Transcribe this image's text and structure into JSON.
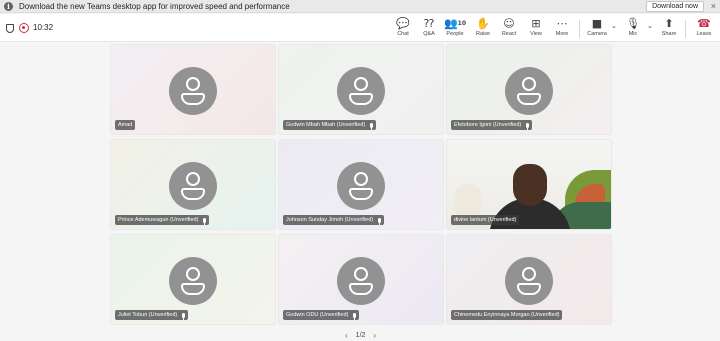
{
  "banner": {
    "message": "Download the new Teams desktop app for improved speed and performance",
    "download_label": "Download now",
    "close_glyph": "×"
  },
  "meeting": {
    "timer": "10:32"
  },
  "toolbar": {
    "chat": {
      "label": "Chat",
      "icon": "chat-icon",
      "glyph": "💬"
    },
    "qa": {
      "label": "Q&A",
      "icon": "qa-icon",
      "glyph": "⁇"
    },
    "people": {
      "label": "People",
      "icon": "people-icon",
      "glyph": "👥",
      "count": "10"
    },
    "raise": {
      "label": "Raise",
      "icon": "hand-icon",
      "glyph": "✋"
    },
    "react": {
      "label": "React",
      "icon": "smile-icon",
      "glyph": "☺"
    },
    "view": {
      "label": "View",
      "icon": "grid-icon",
      "glyph": "⊞"
    },
    "more": {
      "label": "More",
      "icon": "more-icon",
      "glyph": "⋯"
    },
    "camera": {
      "label": "Camera",
      "icon": "camera-icon",
      "glyph": "■"
    },
    "mic": {
      "label": "Mic",
      "icon": "mic-icon",
      "glyph": "🎙"
    },
    "share": {
      "label": "Share",
      "icon": "share-icon",
      "glyph": "⬆"
    },
    "leave": {
      "label": "Leave",
      "icon": "phone-hangup-icon",
      "glyph": "☎",
      "color": "#c4314b"
    },
    "caret_glyph": "⌄"
  },
  "participants": [
    {
      "name": "Amad",
      "mic": false
    },
    {
      "name": "Godwin Mbah Mbah (Unverified)",
      "mic": true
    },
    {
      "name": "Efetobore Igoni (Unverified)",
      "mic": true
    },
    {
      "name": "Prince Ademuwagun (Unverified)",
      "mic": true
    },
    {
      "name": "Johnson Sunday Jimoh (Unverified)",
      "mic": true
    },
    {
      "name": "divine lantum (Unverified)",
      "mic": false,
      "video": true
    },
    {
      "name": "Juliet Tobun (Unverified)",
      "mic": true
    },
    {
      "name": "Godwin ODU (Unverified)",
      "mic": true
    },
    {
      "name": "Chinemedu Enyinnaya Morgan (Unverified)",
      "mic": false
    }
  ],
  "pager": {
    "label": "1/2",
    "prev_glyph": "‹",
    "next_glyph": "›"
  },
  "colors": {
    "record": "#c4314b",
    "avatar": "#929292"
  }
}
